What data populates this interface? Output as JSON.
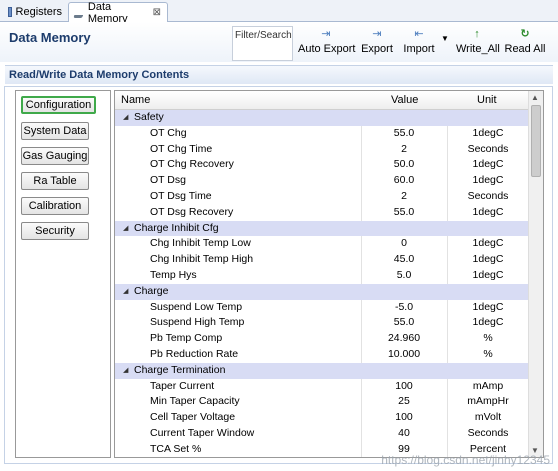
{
  "tabs": [
    {
      "label": "Registers"
    },
    {
      "label": "Data Memory",
      "close": "⊠"
    }
  ],
  "header": {
    "title": "Data Memory",
    "filter_label": "Filter/Search"
  },
  "toolbar": {
    "auto_export": "Auto Export",
    "export": "Export",
    "import": "Import",
    "import_dropdown": "▼",
    "write_all": "Write_All",
    "read_all": "Read All"
  },
  "section": {
    "title": "Read/Write Data Memory Contents"
  },
  "categories": [
    {
      "label": "Configuration"
    },
    {
      "label": "System Data"
    },
    {
      "label": "Gas Gauging"
    },
    {
      "label": "Ra Table"
    },
    {
      "label": "Calibration"
    },
    {
      "label": "Security"
    }
  ],
  "table": {
    "columns": [
      "Name",
      "Value",
      "Unit"
    ],
    "rows": [
      {
        "name": "Safety",
        "group": true
      },
      {
        "name": "OT Chg",
        "value": "55.0",
        "unit": "1degC"
      },
      {
        "name": "OT Chg Time",
        "value": "2",
        "unit": "Seconds"
      },
      {
        "name": "OT Chg Recovery",
        "value": "50.0",
        "unit": "1degC"
      },
      {
        "name": "OT Dsg",
        "value": "60.0",
        "unit": "1degC"
      },
      {
        "name": "OT Dsg Time",
        "value": "2",
        "unit": "Seconds"
      },
      {
        "name": "OT Dsg Recovery",
        "value": "55.0",
        "unit": "1degC"
      },
      {
        "name": "Charge Inhibit Cfg",
        "group": true
      },
      {
        "name": "Chg Inhibit Temp Low",
        "value": "0",
        "unit": "1degC"
      },
      {
        "name": "Chg Inhibit Temp High",
        "value": "45.0",
        "unit": "1degC"
      },
      {
        "name": "Temp Hys",
        "value": "5.0",
        "unit": "1degC"
      },
      {
        "name": "Charge",
        "group": true
      },
      {
        "name": "Suspend Low Temp",
        "value": "-5.0",
        "unit": "1degC"
      },
      {
        "name": "Suspend High Temp",
        "value": "55.0",
        "unit": "1degC"
      },
      {
        "name": "Pb Temp Comp",
        "value": "24.960",
        "unit": "%"
      },
      {
        "name": "Pb Reduction Rate",
        "value": "10.000",
        "unit": "%"
      },
      {
        "name": "Charge Termination",
        "group": true
      },
      {
        "name": "Taper Current",
        "value": "100",
        "unit": "mAmp"
      },
      {
        "name": "Min Taper Capacity",
        "value": "25",
        "unit": "mAmpHr"
      },
      {
        "name": "Cell Taper Voltage",
        "value": "100",
        "unit": "mVolt"
      },
      {
        "name": "Current Taper Window",
        "value": "40",
        "unit": "Seconds"
      },
      {
        "name": "TCA Set %",
        "value": "99",
        "unit": "Percent"
      }
    ]
  },
  "watermark": "https://blog.csdn.net/jinhy12345",
  "colors": {
    "group_row": "#d8dcf4",
    "title_text": "#1d3c6c",
    "selected_border": "#3fa94a"
  }
}
